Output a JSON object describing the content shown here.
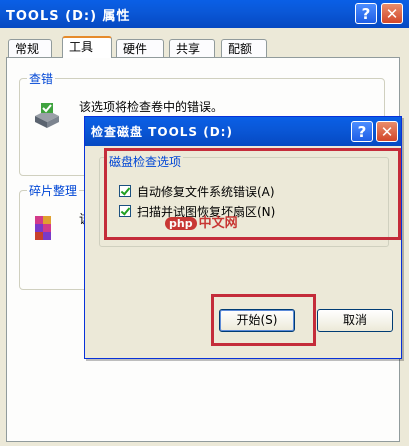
{
  "outer_window": {
    "title": "TOOLS (D:) 属性",
    "help_btn": "?",
    "close_btn": "✕"
  },
  "tabs": [
    "常规",
    "工具",
    "硬件",
    "共享",
    "配额"
  ],
  "active_tab": "工具",
  "tools_panel": {
    "check_group_label": "查错",
    "check_desc": "该选项将检查卷中的错误。",
    "defrag_group_label": "碎片整理",
    "defrag_desc_partial": "该"
  },
  "dialog": {
    "title": "检查磁盘 TOOLS (D:)",
    "help_btn": "?",
    "close_btn": "✕",
    "options_group_label": "磁盘检查选项",
    "options": [
      {
        "label": "自动修复文件系统错误(A)",
        "checked": true
      },
      {
        "label": "扫描并试图恢复坏扇区(N)",
        "checked": true
      }
    ],
    "start_btn": "开始(S)",
    "cancel_btn": "取消"
  },
  "watermark": {
    "badge": "php",
    "text": "中文网"
  }
}
